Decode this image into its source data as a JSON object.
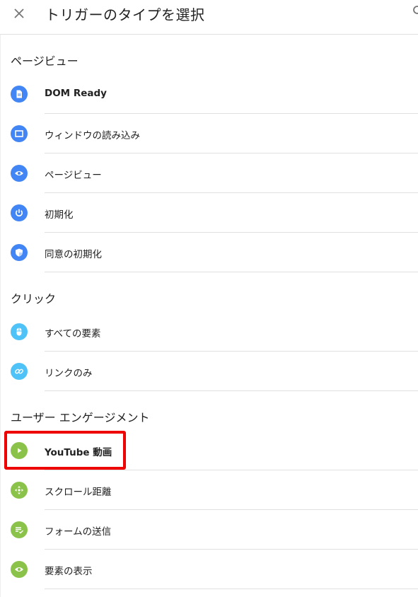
{
  "header": {
    "title": "トリガーのタイプを選択"
  },
  "colors": {
    "blue": "#4285f4",
    "green": "#8bc34a",
    "highlight": "#ee0000"
  },
  "sections": {
    "page_view": {
      "title": "ページビュー",
      "items": [
        {
          "label": "DOM Ready",
          "icon": "document-icon"
        },
        {
          "label": "ウィンドウの読み込み",
          "icon": "window-icon"
        },
        {
          "label": "ページビュー",
          "icon": "eye-icon"
        },
        {
          "label": "初期化",
          "icon": "power-icon"
        },
        {
          "label": "同意の初期化",
          "icon": "shield-icon"
        }
      ]
    },
    "click": {
      "title": "クリック",
      "items": [
        {
          "label": "すべての要素",
          "icon": "mouse-icon"
        },
        {
          "label": "リンクのみ",
          "icon": "link-icon"
        }
      ]
    },
    "engagement": {
      "title": "ユーザー エンゲージメント",
      "items": [
        {
          "label": "YouTube 動画",
          "icon": "play-icon"
        },
        {
          "label": "スクロール距離",
          "icon": "scroll-icon"
        },
        {
          "label": "フォームの送信",
          "icon": "form-icon"
        },
        {
          "label": "要素の表示",
          "icon": "eye-icon"
        }
      ]
    }
  }
}
